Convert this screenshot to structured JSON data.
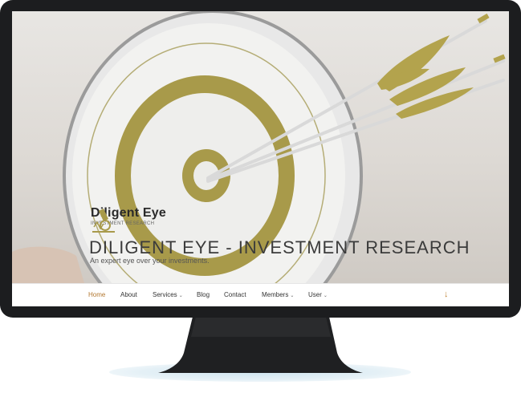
{
  "brand": {
    "name": "Diligent Eye",
    "sub": "INVESTMENT RESEARCH"
  },
  "hero": {
    "title": "DILIGENT EYE - INVESTMENT RESEARCH",
    "tagline": "An expert eye over your investments."
  },
  "nav": {
    "items": [
      {
        "label": "Home",
        "active": true
      },
      {
        "label": "About"
      },
      {
        "label": "Services",
        "dropdown": true
      },
      {
        "label": "Blog"
      },
      {
        "label": "Contact"
      },
      {
        "label": "Members",
        "dropdown": true
      },
      {
        "label": "User",
        "dropdown": true
      }
    ],
    "scroll_icon": "arrow-down-icon"
  },
  "colors": {
    "accent": "#b2772f",
    "monitor": "#1c1d1f",
    "target_gold": "#a89a4a"
  }
}
